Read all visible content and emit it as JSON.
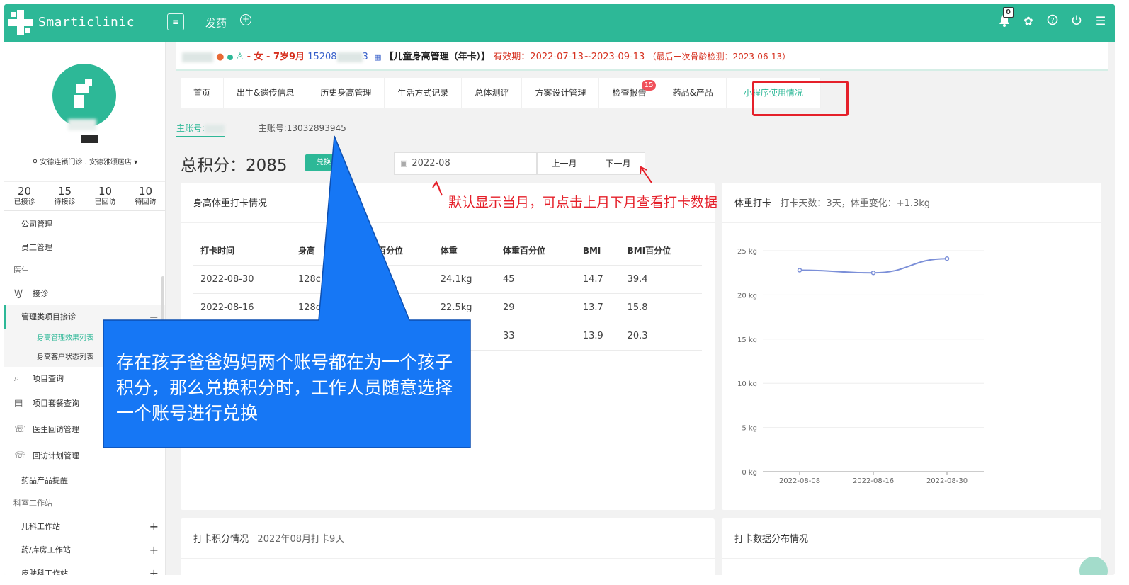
{
  "header": {
    "brand": "Smarticlinic",
    "menu_icon": "menu-icon",
    "page_title": "发药",
    "notification_count": "0",
    "accent_color": "#2db897"
  },
  "sidebar": {
    "store": "安德连锁门诊 . 安德雅颂居店",
    "stats": [
      {
        "num": "20",
        "label": "已接诊"
      },
      {
        "num": "15",
        "label": "待接诊"
      },
      {
        "num": "10",
        "label": "已回访"
      },
      {
        "num": "10",
        "label": "待回访"
      }
    ],
    "nav": {
      "company": "公司管理",
      "staff": "员工管理",
      "doctor_section": "医生",
      "reception": "接诊",
      "mgmt_reception": "管理类项目接诊",
      "sub_effect": "身高管理效果列表",
      "sub_status": "身高客户状态列表",
      "project_query": "项目查询",
      "package_query": "项目套餐查询",
      "doctor_followup": "医生回访管理",
      "followup_plan": "回访计划管理",
      "drug_reminder": "药品产品提醒",
      "dept_section": "科室工作站",
      "pediatric": "儿科工作站",
      "pharmacy": "药/库房工作站",
      "derm": "皮肤科工作站"
    }
  },
  "patient": {
    "gender": "女",
    "age": "7岁9月",
    "phone": "15208",
    "phone_tail": "3",
    "program": "【儿童身高管理（年卡）】",
    "validity": "有效期：2022-07-13~2023-09-13",
    "last_check": "（最后一次骨龄检测：2023-06-13）"
  },
  "tabs": [
    {
      "label": "首页"
    },
    {
      "label": "出生&遗传信息"
    },
    {
      "label": "历史身高管理"
    },
    {
      "label": "生活方式记录"
    },
    {
      "label": "总体测评"
    },
    {
      "label": "方案设计管理"
    },
    {
      "label": "检查报告",
      "badge": "15"
    },
    {
      "label": "药品&产品"
    },
    {
      "label": "小程序使用情况"
    }
  ],
  "accounts": {
    "main_label": "主账号:",
    "second": "主账号:13032893945"
  },
  "points": {
    "label": "总积分：2085",
    "redeem": "兑换",
    "month": "2022-08",
    "prev": "上一月",
    "next": "下一月"
  },
  "checkin_table": {
    "title": "身高体重打卡情况",
    "headers": [
      "打卡时间",
      "身高",
      "身高百分位",
      "体重",
      "体重百分位",
      "BMI",
      "BMI百分位"
    ],
    "rows": [
      [
        "2022-08-30",
        "128cm",
        "",
        "24.1kg",
        "45",
        "14.7",
        "39.4"
      ],
      [
        "2022-08-16",
        "128cm",
        "",
        "22.5kg",
        "29",
        "13.7",
        "15.8"
      ],
      [
        "",
        "",
        "",
        "",
        "33",
        "13.9",
        "20.3"
      ]
    ]
  },
  "weight_card": {
    "title": "体重打卡",
    "summary": "打卡天数：3天，体重变化：+1.3kg"
  },
  "chart_data": {
    "type": "line",
    "x": [
      "2022-08-08",
      "2022-08-16",
      "2022-08-30"
    ],
    "series": [
      {
        "values": [
          22.8,
          22.5,
          24.1
        ],
        "color": "#7b8fd8"
      }
    ],
    "yticks": [
      "0 kg",
      "5 kg",
      "10 kg",
      "15 kg",
      "20 kg",
      "25 kg"
    ],
    "ylim": [
      0,
      25
    ],
    "grid": true
  },
  "bottom_left": {
    "title": "打卡积分情况",
    "subtitle": "2022年08月打卡9天"
  },
  "bottom_right": {
    "title": "打卡数据分布情况"
  },
  "annotations": {
    "red_note": "默认显示当月，可点击上月下月查看打卡数据",
    "callout": "存在孩子爸爸妈妈两个账号都在为一个孩子积分，那么兑换积分时，工作人员随意选择一个账号进行兑换",
    "red_color": "#e5202a",
    "callout_color": "#1677f5"
  }
}
